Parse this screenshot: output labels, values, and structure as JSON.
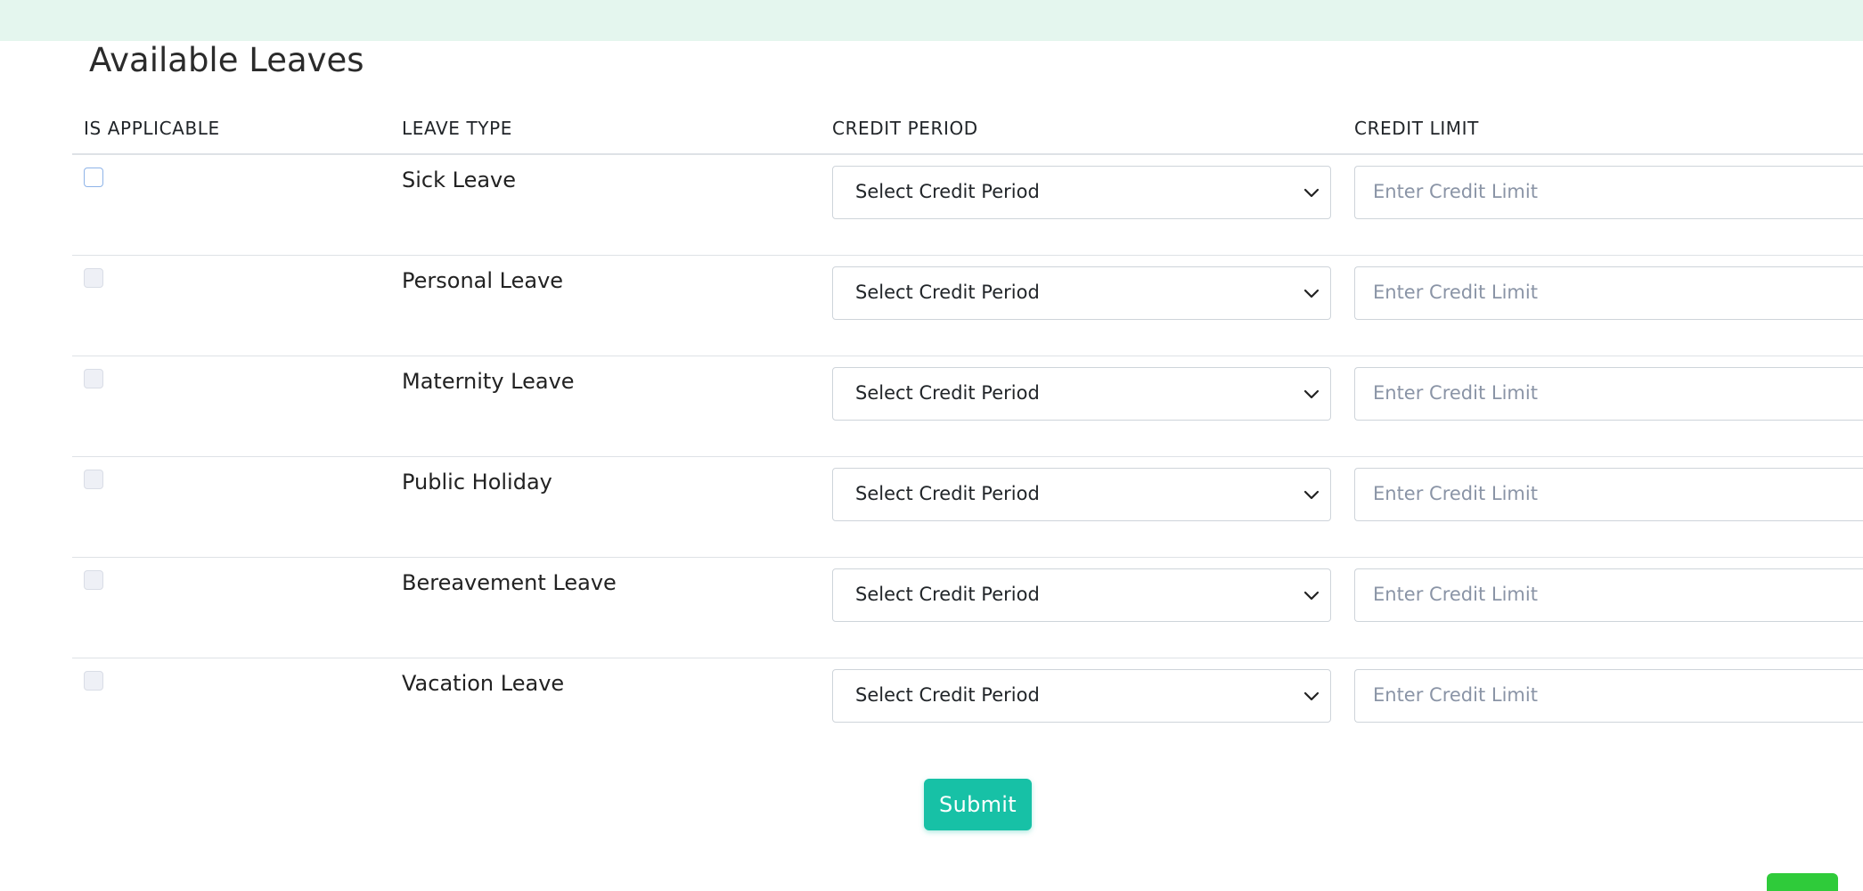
{
  "title": "Available Leaves",
  "table": {
    "headers": [
      "IS APPLICABLE",
      "LEAVE TYPE",
      "CREDIT PERIOD",
      "CREDIT LIMIT"
    ],
    "rows": [
      {
        "leave_type": "Sick Leave",
        "credit_period": "Select Credit Period",
        "credit_limit_placeholder": "Enter Credit Limit"
      },
      {
        "leave_type": "Personal Leave",
        "credit_period": "Select Credit Period",
        "credit_limit_placeholder": "Enter Credit Limit"
      },
      {
        "leave_type": "Maternity Leave",
        "credit_period": "Select Credit Period",
        "credit_limit_placeholder": "Enter Credit Limit"
      },
      {
        "leave_type": "Public Holiday",
        "credit_period": "Select Credit Period",
        "credit_limit_placeholder": "Enter Credit Limit"
      },
      {
        "leave_type": "Bereavement Leave",
        "credit_period": "Select Credit Period",
        "credit_limit_placeholder": "Enter Credit Limit"
      },
      {
        "leave_type": "Vacation Leave",
        "credit_period": "Select Credit Period",
        "credit_limit_placeholder": "Enter Credit Limit"
      }
    ]
  },
  "submit_label": "Submit",
  "colors": {
    "banner": "#e4f6ee",
    "submit": "#17c1a6",
    "corner_button": "#2fcb3a"
  },
  "icons": {
    "select_arrow": "chevron-down-icon"
  }
}
